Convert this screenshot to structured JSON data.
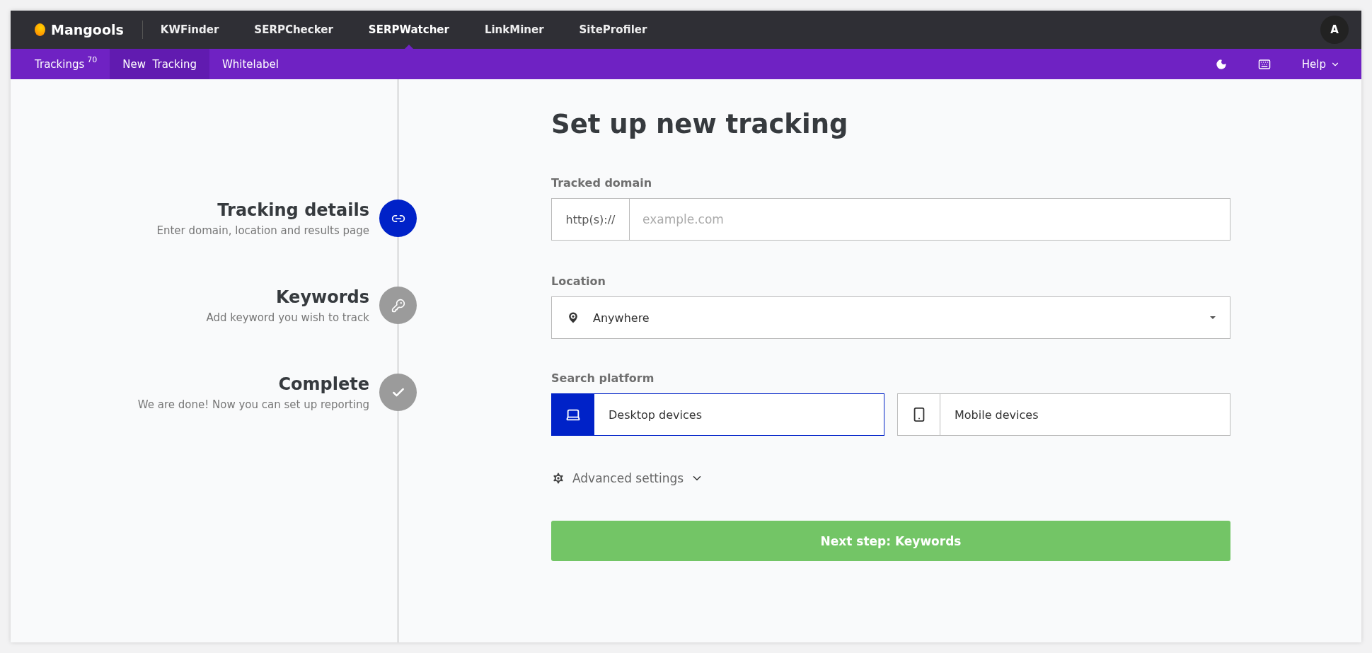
{
  "topbar": {
    "logo": "Mangools",
    "apps": [
      {
        "label": "KWFinder",
        "selected": false
      },
      {
        "label": "SERPChecker",
        "selected": false
      },
      {
        "label": "SERPWatcher",
        "selected": true
      },
      {
        "label": "LinkMiner",
        "selected": false
      },
      {
        "label": "SiteProfiler",
        "selected": false
      }
    ],
    "avatar": "A"
  },
  "subnav": {
    "items": [
      {
        "label": "Trackings",
        "count": "70",
        "selected": false
      },
      {
        "label": "New  Tracking",
        "selected": true
      },
      {
        "label": "Whitelabel",
        "selected": false
      }
    ],
    "help": "Help"
  },
  "steps": [
    {
      "title": "Tracking details",
      "subtitle": "Enter domain, location and results page",
      "kind": "link",
      "selected": true
    },
    {
      "title": "Keywords",
      "subtitle": "Add keyword you wish to track",
      "kind": "key",
      "selected": false
    },
    {
      "title": "Complete",
      "subtitle": "We are done! Now you can set up reporting",
      "kind": "check",
      "selected": false
    }
  ],
  "form": {
    "title": "Set up new tracking",
    "domain_label": "Tracked domain",
    "domain_prefix": "http(s)://",
    "domain_placeholder": "example.com",
    "location_label": "Location",
    "location_value": "Anywhere",
    "platform_label": "Search platform",
    "platforms": [
      {
        "label": "Desktop devices",
        "kind": "desktop",
        "selected": true
      },
      {
        "label": "Mobile devices",
        "kind": "mobile",
        "selected": false
      }
    ],
    "advanced": "Advanced settings",
    "submit": "Next step: Keywords"
  }
}
